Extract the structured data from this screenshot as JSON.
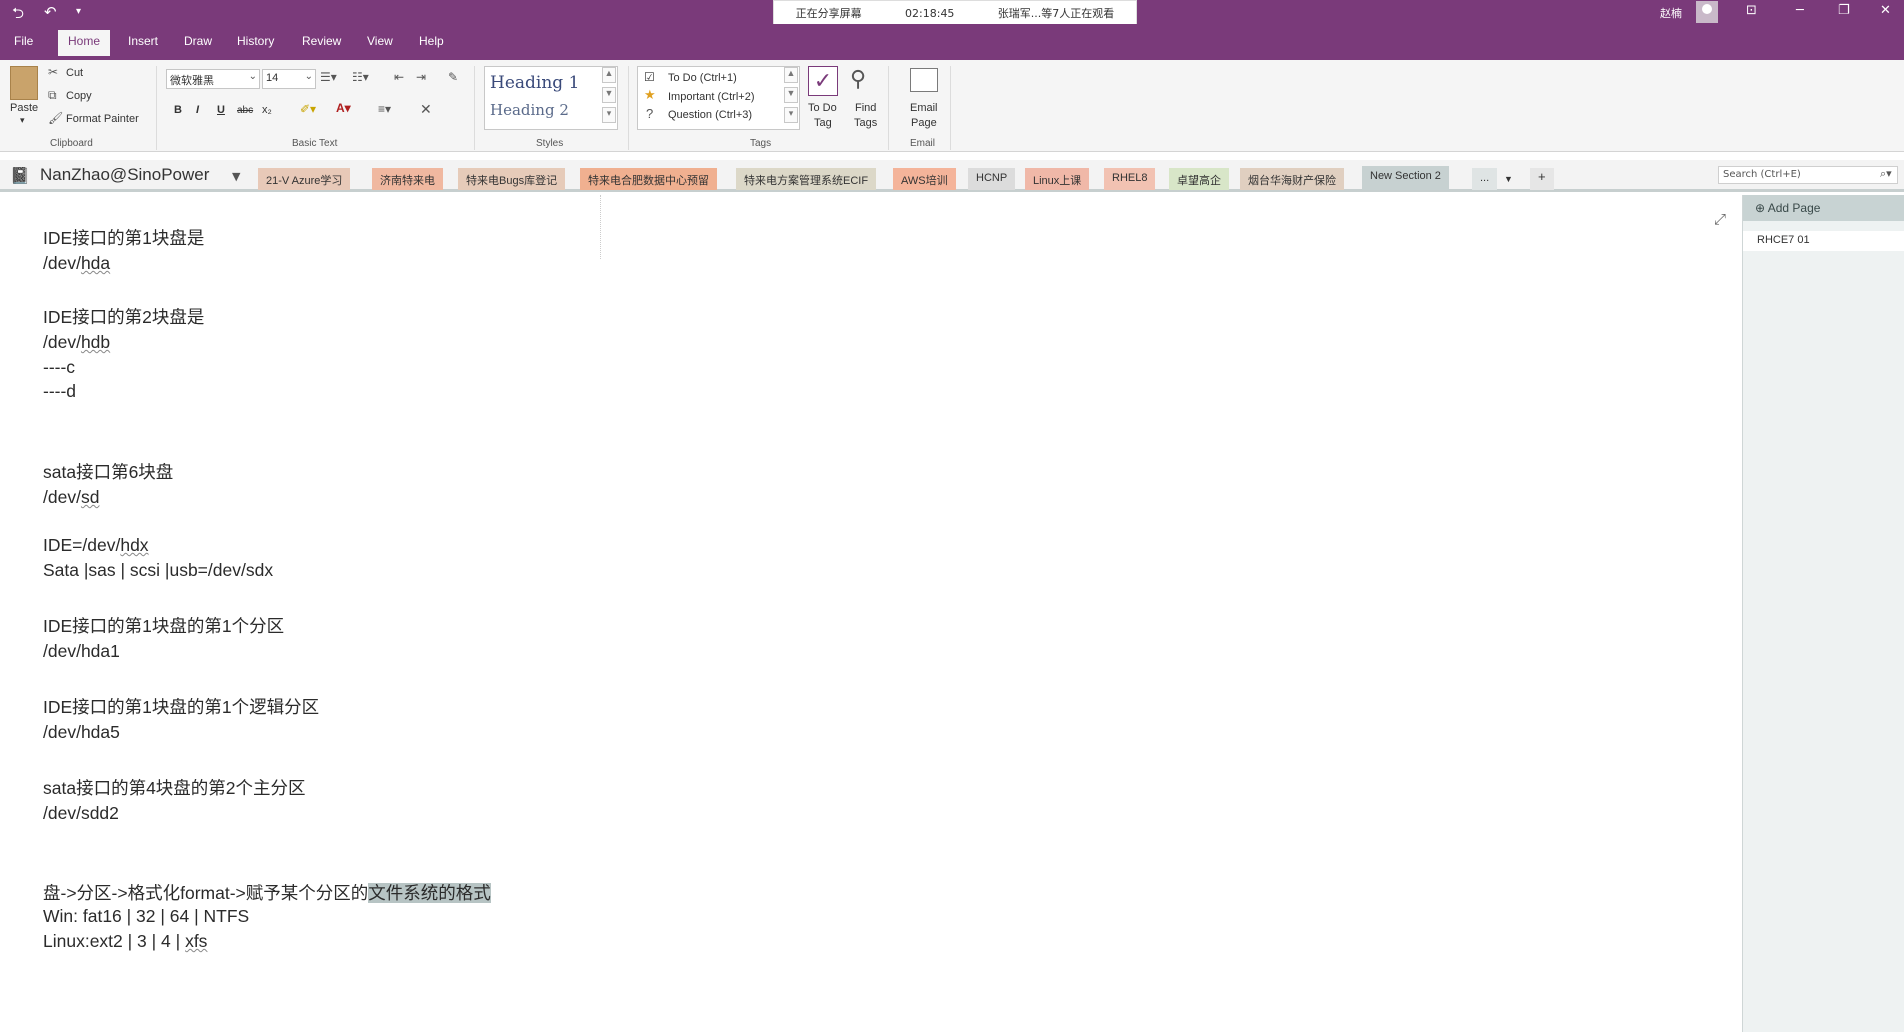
{
  "titlebar": {
    "back_icon": "back-circle-icon",
    "undo_icon": "undo-icon",
    "customize_icon": "chevron-down-icon",
    "share_status": "正在分享屏幕",
    "share_time": "02:18:45",
    "viewers": "张瑞军...等7人正在观看",
    "user_name": "赵楠",
    "colors": {
      "brand": "#7a3a7a",
      "ribbon": "#f5f5f5"
    }
  },
  "ribbon_tabs": [
    "File",
    "Home",
    "Insert",
    "Draw",
    "History",
    "Review",
    "View",
    "Help"
  ],
  "clipboard": {
    "paste": "Paste",
    "cut": "Cut",
    "copy": "Copy",
    "format_painter": "Format Painter",
    "group_label": "Clipboard"
  },
  "basic_text": {
    "font_name": "微软雅黑",
    "font_size": "14",
    "bold": "B",
    "italic": "I",
    "underline": "U",
    "strike": "abc",
    "subscript": "x₂",
    "group_label": "Basic Text"
  },
  "styles": {
    "heading1": "Heading 1",
    "heading2": "Heading 2",
    "group_label": "Styles"
  },
  "tags": {
    "todo": "To Do (Ctrl+1)",
    "important": "Important (Ctrl+2)",
    "question": "Question (Ctrl+3)",
    "todo_tag_l1": "To Do",
    "todo_tag_l2": "Tag",
    "find_tags_l1": "Find",
    "find_tags_l2": "Tags",
    "group_label": "Tags"
  },
  "email": {
    "l1": "Email",
    "l2": "Page",
    "group_label": "Email"
  },
  "notebook": {
    "name": "NanZhao@SinoPower",
    "sections": [
      {
        "label": "21-V Azure学习",
        "color": "#e8c9b8"
      },
      {
        "label": "济南特来电",
        "color": "#f0b8a0"
      },
      {
        "label": "特来电Bugs库登记",
        "color": "#e6cbb9"
      },
      {
        "label": "特来电合肥数据中心预留",
        "color": "#f0b090"
      },
      {
        "label": "特来电方案管理系统ECIF",
        "color": "#dcd8c8"
      },
      {
        "label": "AWS培训",
        "color": "#f4b49a"
      },
      {
        "label": "HCNP",
        "color": "#dcdcdc"
      },
      {
        "label": "Linux上课",
        "color": "#f0b8a8"
      },
      {
        "label": "RHEL8",
        "color": "#f2c2b2"
      },
      {
        "label": "卓望高企",
        "color": "#d8e6c8"
      },
      {
        "label": "烟台华海财产保险",
        "color": "#e0cfc0"
      },
      {
        "label": "New Section 2",
        "color": "#c7d1d1"
      }
    ],
    "more": "...",
    "add": "+",
    "search_placeholder": "Search (Ctrl+E)"
  },
  "page_lines": [
    {
      "text": "IDE接口的第1块盘是"
    },
    {
      "text": "/dev/hda"
    },
    {
      "text": "IDE接口的第2块盘是"
    },
    {
      "text": "/dev/hdb"
    },
    {
      "text": "----c"
    },
    {
      "text": "----d"
    },
    {
      "text": "sata接口第6块盘"
    },
    {
      "text": "/dev/sd"
    },
    {
      "text": "IDE=/dev/hdx"
    },
    {
      "text": "Sata |sas | scsi |usb=/dev/sdx"
    },
    {
      "text": "IDE接口的第1块盘的第1个分区"
    },
    {
      "text": "/dev/hda1"
    },
    {
      "text": "IDE接口的第1块盘的第1个逻辑分区"
    },
    {
      "text": "/dev/hda5"
    },
    {
      "text": "sata接口的第4块盘的第2个主分区"
    },
    {
      "text": "/dev/sdd2"
    },
    {
      "text_before": "盘->分区->格式化format->赋予某个分区的",
      "text_highlight": "文件系统的格式"
    },
    {
      "text": "Win: fat16 | 32 | 64 | NTFS"
    },
    {
      "text": "Linux:ext2 | 3 | 4 | xfs"
    }
  ],
  "pages_pane": {
    "add_page": "Add Page",
    "items": [
      "RHCE7 01"
    ]
  }
}
